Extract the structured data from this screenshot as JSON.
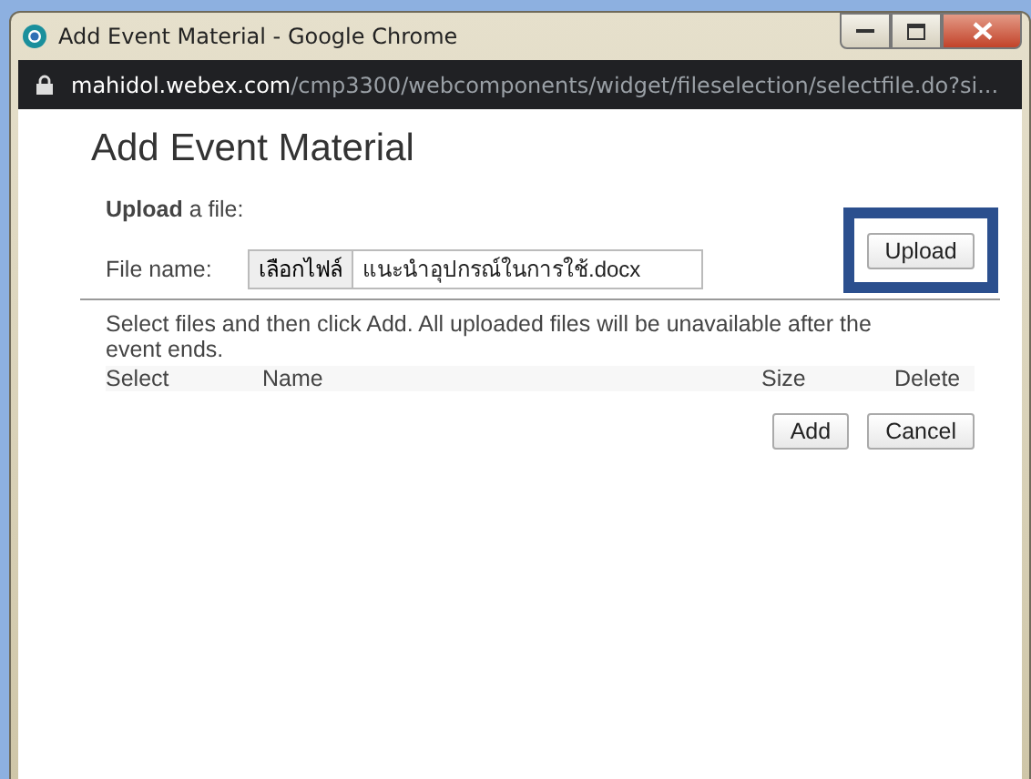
{
  "window": {
    "title": "Add Event Material - Google Chrome"
  },
  "address_bar": {
    "domain": "mahidol.webex.com",
    "path": "/cmp3300/webcomponents/widget/fileselection/selectfile.do?si..."
  },
  "heading": "Add Event Material",
  "upload": {
    "label": "**Upload** a file:",
    "file_label": "File name:",
    "choose_button": "เลือกไฟล์",
    "file_value": "แนะนำอุปกรณ์ในการใช้.docx",
    "upload_button": "Upload"
  },
  "instructions": "Select files and then click Add. All uploaded files will be unavailable after the event ends.",
  "table": {
    "columns": [
      "Select",
      "Name",
      "Size",
      "Delete"
    ]
  },
  "buttons": [
    "Add",
    "Cancel"
  ]
}
